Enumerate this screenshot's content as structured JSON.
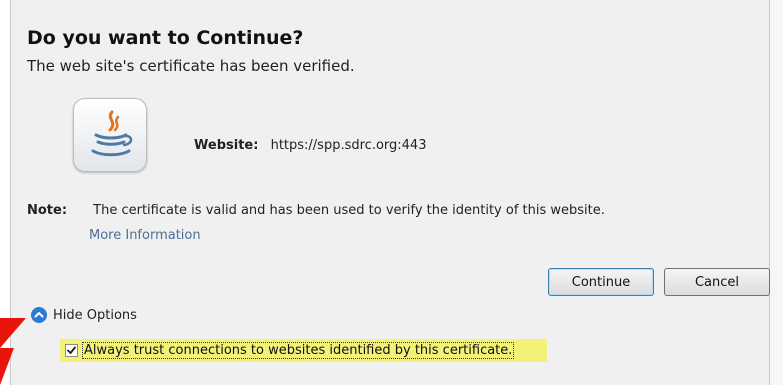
{
  "dialog": {
    "title": "Do you want to Continue?",
    "subtitle": "The web site's certificate has been verified.",
    "app_icon": "java-icon",
    "website": {
      "label": "Website:",
      "value": "https://spp.sdrc.org:443"
    },
    "note": {
      "label": "Note:",
      "text": "The certificate is valid and has been used to verify the identity of this website."
    },
    "more_info": "More Information",
    "buttons": {
      "continue": "Continue",
      "cancel": "Cancel"
    },
    "options_toggle": {
      "label": "Hide Options",
      "icon": "chevron-up-icon"
    },
    "trust_checkbox": {
      "label": "Always trust connections to websites identified by this certificate.",
      "checked": true
    },
    "highlight_color": "#f2f279",
    "accent_color": "#2b7ad3",
    "annotation_arrow_color": "#e8150c"
  }
}
